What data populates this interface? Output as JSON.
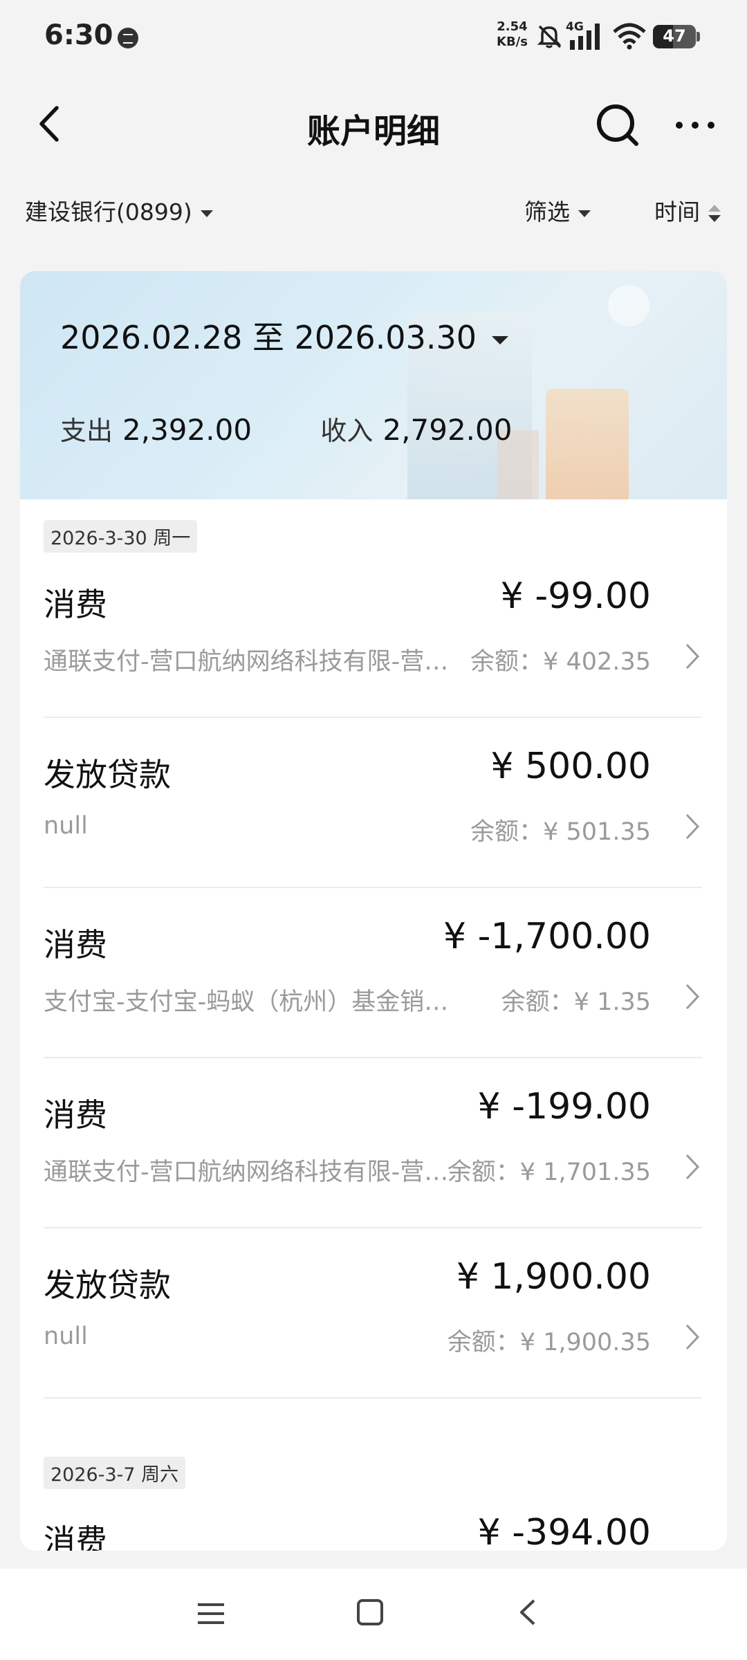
{
  "status_bar": {
    "time": "6:30",
    "net_speed_value": "2.54",
    "net_speed_unit": "KB/s",
    "network": "4G",
    "battery": "47",
    "icons": [
      "message-icon",
      "mute-bell-icon",
      "signal-icon",
      "wifi-icon",
      "battery-icon"
    ]
  },
  "header": {
    "title": "账户明细",
    "icons": [
      "back-arrow-icon",
      "search-icon",
      "more-icon"
    ]
  },
  "filters": {
    "account": "建设银行(0899)",
    "filter_label": "筛选",
    "time_label": "时间"
  },
  "summary": {
    "date_range": "2026.02.28 至 2026.03.30",
    "expense_label": "支出",
    "expense_value": "2,392.00",
    "income_label": "收入",
    "income_value": "2,792.00"
  },
  "groups": [
    {
      "date": "2026-3-30 周一",
      "transactions": [
        {
          "type": "消费",
          "amount": "¥ -99.00",
          "description": "通联支付-营口航纳网络科技有限-营…",
          "balance": "余额：¥ 402.35"
        },
        {
          "type": "发放贷款",
          "amount": "¥ 500.00",
          "description": "null",
          "balance": "余额：¥ 501.35"
        },
        {
          "type": "消费",
          "amount": "¥ -1,700.00",
          "description": "支付宝-支付宝-蚂蚁（杭州）基金销…",
          "balance": "余额：¥ 1.35"
        },
        {
          "type": "消费",
          "amount": "¥ -199.00",
          "description": "通联支付-营口航纳网络科技有限-营…",
          "balance": "余额：¥ 1,701.35"
        },
        {
          "type": "发放贷款",
          "amount": "¥ 1,900.00",
          "description": "null",
          "balance": "余额：¥ 1,900.35"
        }
      ]
    },
    {
      "date": "2026-3-7 周六",
      "transactions": [
        {
          "type": "消费",
          "amount": "¥ -394.00"
        }
      ]
    }
  ],
  "nav_bar": {
    "icons": [
      "menu-icon",
      "home-square-icon",
      "back-triangle-icon"
    ]
  }
}
